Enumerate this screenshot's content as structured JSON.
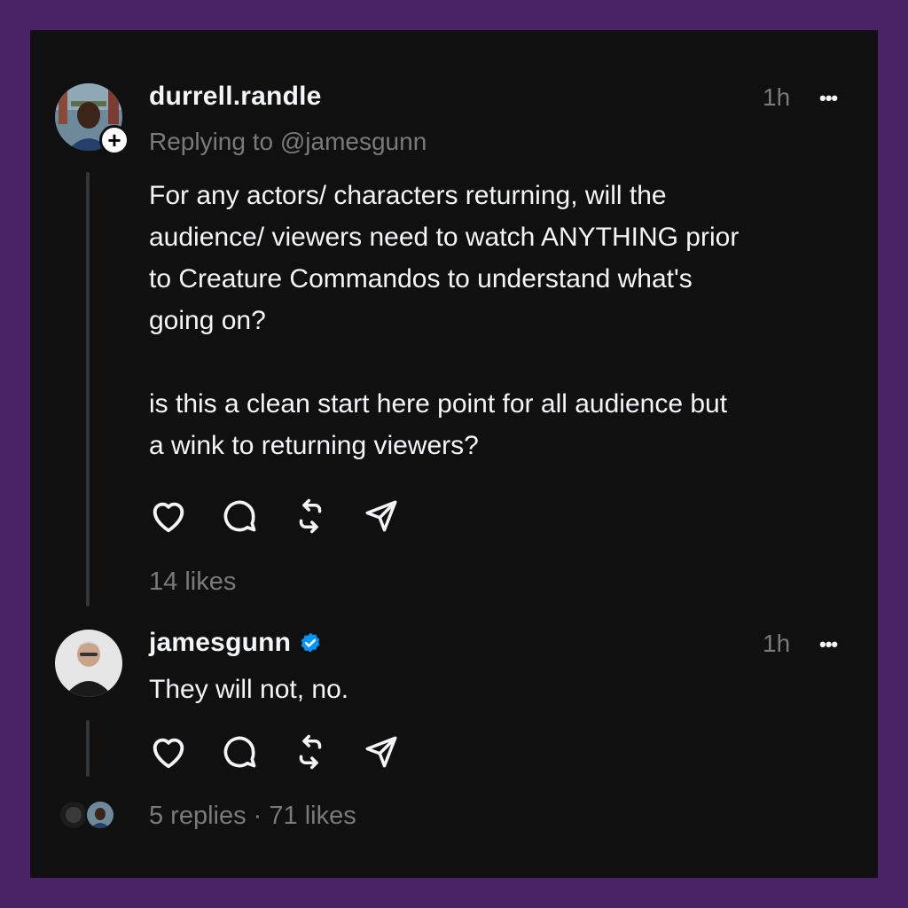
{
  "post": {
    "username": "durrell.randle",
    "replying_to": "Replying to @jamesgunn",
    "time": "1h",
    "more": "•••",
    "follow_badge": "+",
    "text": "For any actors/ characters returning, will the\naudience/ viewers need to watch ANYTHING prior\nto Creature Commandos to understand what's\ngoing on?\n\nis this a clean start here point for all audience but\na wink to returning viewers?",
    "likes": "14 likes",
    "actions": [
      "heart-icon",
      "comment-icon",
      "repost-icon",
      "share-icon"
    ]
  },
  "reply": {
    "username": "jamesgunn",
    "verified": true,
    "time": "1h",
    "more": "•••",
    "text": "They will not, no.",
    "actions": [
      "heart-icon",
      "comment-icon",
      "repost-icon",
      "share-icon"
    ]
  },
  "footer": {
    "summary": "5 replies · 71 likes"
  },
  "colors": {
    "frame": "#4a2266",
    "card": "#101010",
    "text": "#f3f5f7",
    "muted": "#7a7a7a",
    "verified": "#0095f6"
  }
}
